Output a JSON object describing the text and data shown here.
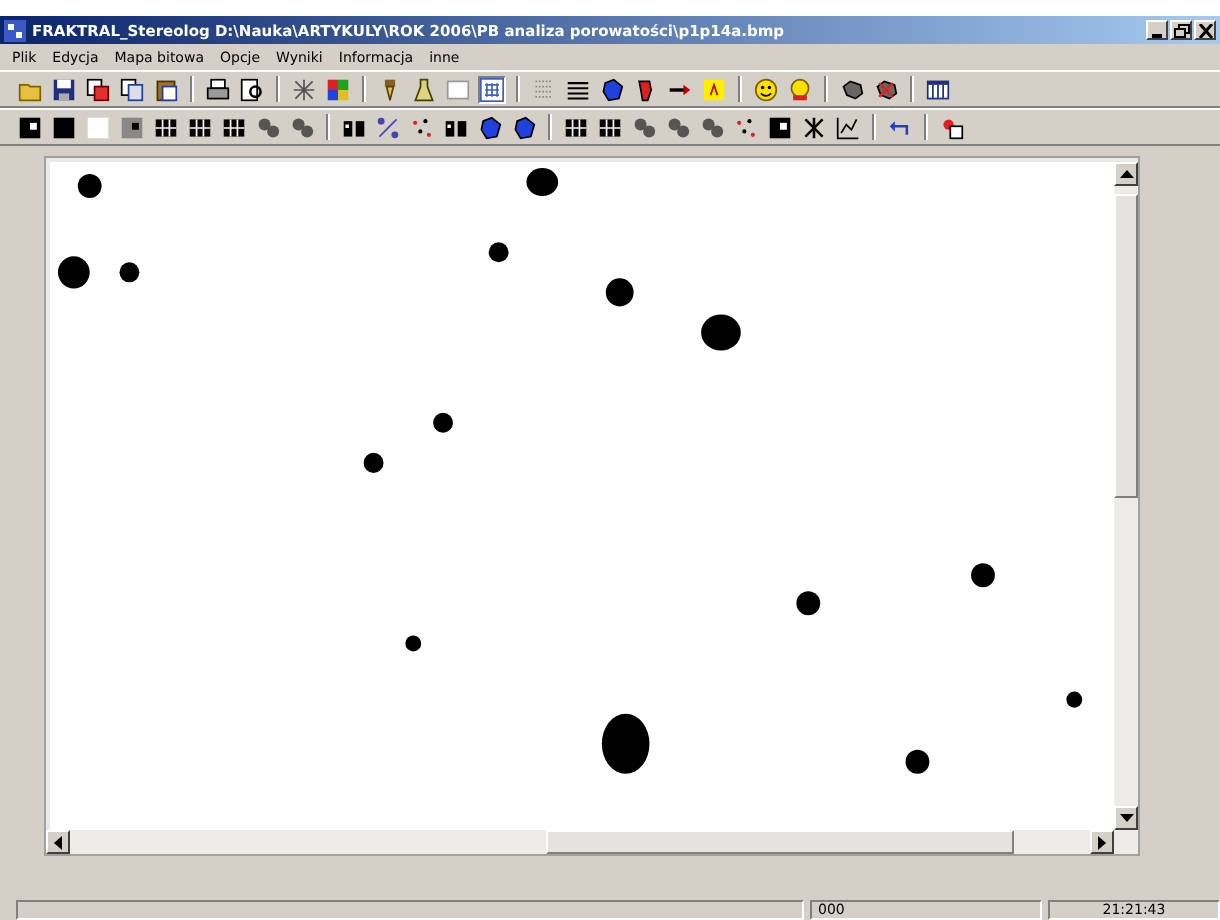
{
  "window": {
    "title": "FRAKTRAL_Stereolog  D:\\Nauka\\ARTYKULY\\ROK 2006\\PB analiza porowatości\\p1p14a.bmp"
  },
  "menu": [
    {
      "label": "Plik"
    },
    {
      "label": "Edycja"
    },
    {
      "label": "Mapa bitowa"
    },
    {
      "label": "Opcje"
    },
    {
      "label": "Wyniki"
    },
    {
      "label": "Informacja"
    },
    {
      "label": "inne"
    }
  ],
  "status_bar": [
    {
      "text": "000"
    },
    {
      "text": "21:21:43"
    }
  ]
}
